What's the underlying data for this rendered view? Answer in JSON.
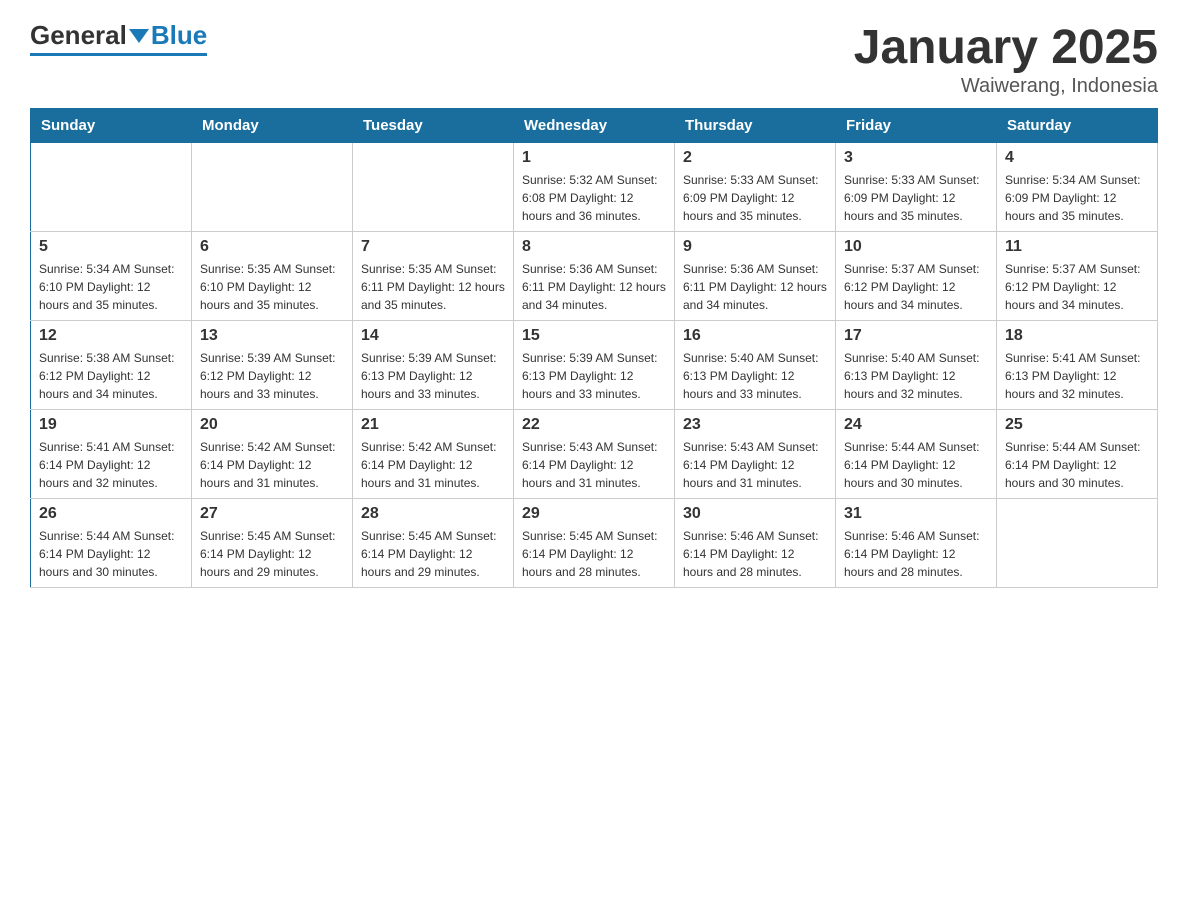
{
  "header": {
    "logo_general": "General",
    "logo_blue": "Blue",
    "month_title": "January 2025",
    "location": "Waiwerang, Indonesia"
  },
  "days_of_week": [
    "Sunday",
    "Monday",
    "Tuesday",
    "Wednesday",
    "Thursday",
    "Friday",
    "Saturday"
  ],
  "weeks": [
    [
      {
        "day": "",
        "info": ""
      },
      {
        "day": "",
        "info": ""
      },
      {
        "day": "",
        "info": ""
      },
      {
        "day": "1",
        "info": "Sunrise: 5:32 AM\nSunset: 6:08 PM\nDaylight: 12 hours\nand 36 minutes."
      },
      {
        "day": "2",
        "info": "Sunrise: 5:33 AM\nSunset: 6:09 PM\nDaylight: 12 hours\nand 35 minutes."
      },
      {
        "day": "3",
        "info": "Sunrise: 5:33 AM\nSunset: 6:09 PM\nDaylight: 12 hours\nand 35 minutes."
      },
      {
        "day": "4",
        "info": "Sunrise: 5:34 AM\nSunset: 6:09 PM\nDaylight: 12 hours\nand 35 minutes."
      }
    ],
    [
      {
        "day": "5",
        "info": "Sunrise: 5:34 AM\nSunset: 6:10 PM\nDaylight: 12 hours\nand 35 minutes."
      },
      {
        "day": "6",
        "info": "Sunrise: 5:35 AM\nSunset: 6:10 PM\nDaylight: 12 hours\nand 35 minutes."
      },
      {
        "day": "7",
        "info": "Sunrise: 5:35 AM\nSunset: 6:11 PM\nDaylight: 12 hours\nand 35 minutes."
      },
      {
        "day": "8",
        "info": "Sunrise: 5:36 AM\nSunset: 6:11 PM\nDaylight: 12 hours\nand 34 minutes."
      },
      {
        "day": "9",
        "info": "Sunrise: 5:36 AM\nSunset: 6:11 PM\nDaylight: 12 hours\nand 34 minutes."
      },
      {
        "day": "10",
        "info": "Sunrise: 5:37 AM\nSunset: 6:12 PM\nDaylight: 12 hours\nand 34 minutes."
      },
      {
        "day": "11",
        "info": "Sunrise: 5:37 AM\nSunset: 6:12 PM\nDaylight: 12 hours\nand 34 minutes."
      }
    ],
    [
      {
        "day": "12",
        "info": "Sunrise: 5:38 AM\nSunset: 6:12 PM\nDaylight: 12 hours\nand 34 minutes."
      },
      {
        "day": "13",
        "info": "Sunrise: 5:39 AM\nSunset: 6:12 PM\nDaylight: 12 hours\nand 33 minutes."
      },
      {
        "day": "14",
        "info": "Sunrise: 5:39 AM\nSunset: 6:13 PM\nDaylight: 12 hours\nand 33 minutes."
      },
      {
        "day": "15",
        "info": "Sunrise: 5:39 AM\nSunset: 6:13 PM\nDaylight: 12 hours\nand 33 minutes."
      },
      {
        "day": "16",
        "info": "Sunrise: 5:40 AM\nSunset: 6:13 PM\nDaylight: 12 hours\nand 33 minutes."
      },
      {
        "day": "17",
        "info": "Sunrise: 5:40 AM\nSunset: 6:13 PM\nDaylight: 12 hours\nand 32 minutes."
      },
      {
        "day": "18",
        "info": "Sunrise: 5:41 AM\nSunset: 6:13 PM\nDaylight: 12 hours\nand 32 minutes."
      }
    ],
    [
      {
        "day": "19",
        "info": "Sunrise: 5:41 AM\nSunset: 6:14 PM\nDaylight: 12 hours\nand 32 minutes."
      },
      {
        "day": "20",
        "info": "Sunrise: 5:42 AM\nSunset: 6:14 PM\nDaylight: 12 hours\nand 31 minutes."
      },
      {
        "day": "21",
        "info": "Sunrise: 5:42 AM\nSunset: 6:14 PM\nDaylight: 12 hours\nand 31 minutes."
      },
      {
        "day": "22",
        "info": "Sunrise: 5:43 AM\nSunset: 6:14 PM\nDaylight: 12 hours\nand 31 minutes."
      },
      {
        "day": "23",
        "info": "Sunrise: 5:43 AM\nSunset: 6:14 PM\nDaylight: 12 hours\nand 31 minutes."
      },
      {
        "day": "24",
        "info": "Sunrise: 5:44 AM\nSunset: 6:14 PM\nDaylight: 12 hours\nand 30 minutes."
      },
      {
        "day": "25",
        "info": "Sunrise: 5:44 AM\nSunset: 6:14 PM\nDaylight: 12 hours\nand 30 minutes."
      }
    ],
    [
      {
        "day": "26",
        "info": "Sunrise: 5:44 AM\nSunset: 6:14 PM\nDaylight: 12 hours\nand 30 minutes."
      },
      {
        "day": "27",
        "info": "Sunrise: 5:45 AM\nSunset: 6:14 PM\nDaylight: 12 hours\nand 29 minutes."
      },
      {
        "day": "28",
        "info": "Sunrise: 5:45 AM\nSunset: 6:14 PM\nDaylight: 12 hours\nand 29 minutes."
      },
      {
        "day": "29",
        "info": "Sunrise: 5:45 AM\nSunset: 6:14 PM\nDaylight: 12 hours\nand 28 minutes."
      },
      {
        "day": "30",
        "info": "Sunrise: 5:46 AM\nSunset: 6:14 PM\nDaylight: 12 hours\nand 28 minutes."
      },
      {
        "day": "31",
        "info": "Sunrise: 5:46 AM\nSunset: 6:14 PM\nDaylight: 12 hours\nand 28 minutes."
      },
      {
        "day": "",
        "info": ""
      }
    ]
  ]
}
